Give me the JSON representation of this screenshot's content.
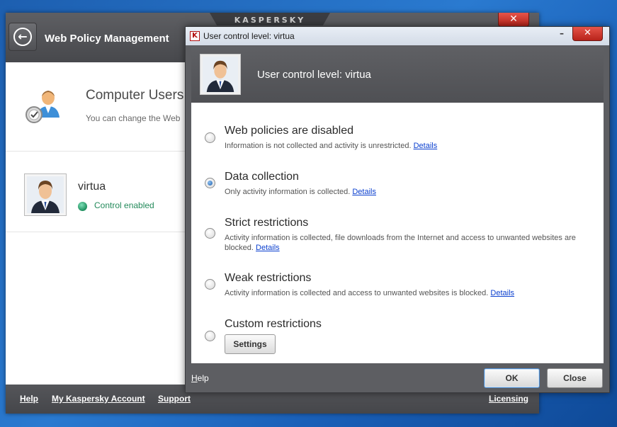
{
  "main_window": {
    "brand": "KASPERSKY",
    "close_glyph": "✕",
    "back_glyph": "←",
    "title": "Web Policy Management",
    "section": {
      "title": "Computer Users",
      "description": "You can change the Web"
    },
    "user": {
      "name": "virtua",
      "status": "Control enabled",
      "status_color": "#248a5b"
    },
    "footer": {
      "help": "Help",
      "account": "My Kaspersky Account",
      "support": "Support",
      "licensing": "Licensing"
    }
  },
  "dialog": {
    "window_title": "User control level: virtua",
    "app_icon_glyph": "K",
    "min_glyph": "–",
    "close_glyph": "✕",
    "header_title": "User control level: virtua",
    "selected_option": "data-collection",
    "options": [
      {
        "id": "web-policies-disabled",
        "title": "Web policies are disabled",
        "description": "Information is not collected and activity is unrestricted.",
        "link": "Details"
      },
      {
        "id": "data-collection",
        "title": "Data collection",
        "description": "Only activity information is collected.",
        "link": "Details"
      },
      {
        "id": "strict-restrictions",
        "title": "Strict restrictions",
        "description": "Activity information is collected, file downloads from the Internet and access to unwanted websites are blocked.",
        "link": "Details"
      },
      {
        "id": "weak-restrictions",
        "title": "Weak restrictions",
        "description": "Activity information is collected and access to unwanted websites is blocked.",
        "link": "Details"
      },
      {
        "id": "custom-restrictions",
        "title": "Custom restrictions",
        "button": "Settings"
      }
    ],
    "footer": {
      "help_first": "H",
      "help_rest": "elp",
      "ok": "OK",
      "close": "Close"
    }
  }
}
